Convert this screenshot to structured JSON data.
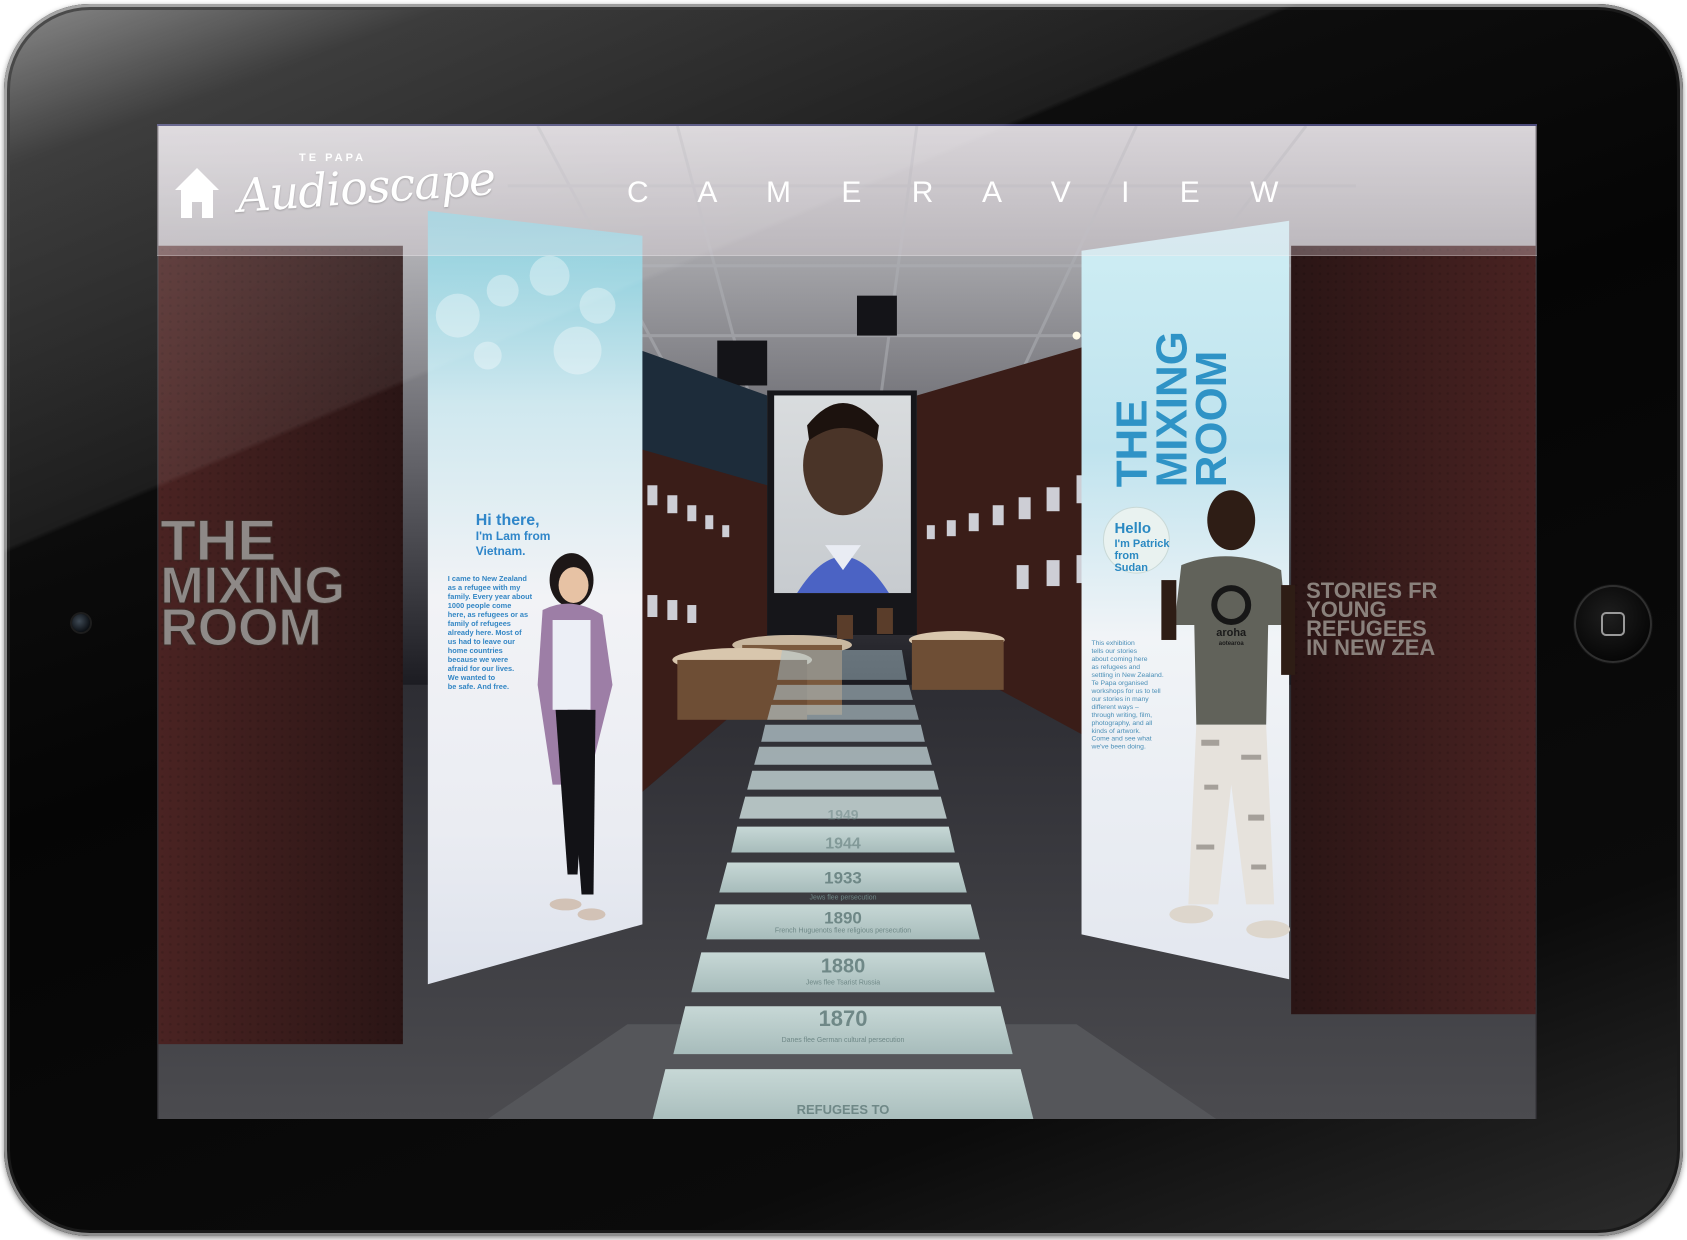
{
  "app": {
    "logo_small": "TE PAPA",
    "logo_script": "Audioscape"
  },
  "header": {
    "title": "C A M E R A   V I E W"
  },
  "icons": {
    "home": "home-icon"
  },
  "scene": {
    "left_panel": {
      "heading": [
        "Hi there,",
        "I'm Lam from",
        "Vietnam."
      ],
      "body": [
        "I came to New Zealand",
        "as a refugee with my",
        "family. Every year about",
        "1000 people come",
        "here, as refugees or as",
        "family of refugees",
        "already here. Most of",
        "us had to leave our",
        "home countries",
        "because we were",
        "afraid for our lives.",
        "We wanted to",
        "be safe. And free."
      ]
    },
    "left_wall_sign": [
      "THE",
      "MIXING",
      "ROOM"
    ],
    "right_panel": {
      "title": [
        "THE",
        "MIXING",
        "ROOM"
      ],
      "heading": [
        "Hello",
        "I'm Patrick",
        "from",
        "Sudan"
      ],
      "body": [
        "This exhibition",
        "tells our stories",
        "about coming here",
        "as refugees and",
        "settling in New Zealand.",
        "Te Papa organised",
        "workshops for us to tell",
        "our stories in many",
        "different ways –",
        "through writing, film,",
        "photography, and all",
        "kinds of artwork.",
        "Come and see what",
        "we've been doing."
      ],
      "shirt_text": [
        "aroha",
        "aotearoa"
      ]
    },
    "right_wall_sign": [
      "STORIES FR",
      "YOUNG",
      "REFUGEES",
      "IN NEW ZEA"
    ],
    "floor_years": [
      "1870",
      "1880",
      "1890",
      "1933",
      "1944",
      "1949"
    ],
    "floor_captions": [
      "Danes flee German cultural persecution",
      "Jews flee Tsarist Russia",
      "French Huguenots flee religious persecution",
      "Jews flee persecution"
    ],
    "floor_bottom": "REFUGEES TO"
  }
}
